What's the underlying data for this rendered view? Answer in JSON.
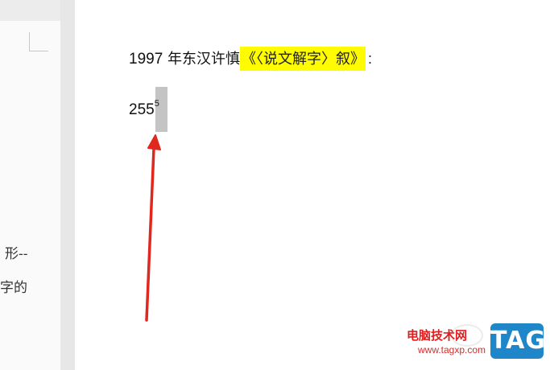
{
  "left_page": {
    "line1": "形--",
    "line2": "字的"
  },
  "document": {
    "para1": {
      "year": "1997",
      "text": " 年东汉许慎",
      "highlighted": "《〈说文解字〉叙》",
      "colon": ":"
    },
    "para2": {
      "base": "255",
      "superscript": "5"
    }
  },
  "watermark": {
    "site_name": "电脑技术网",
    "url": "www.tagxp.com",
    "logo_text": "TAG"
  },
  "colors": {
    "highlight": "#fffb00",
    "arrow": "#e0281e",
    "logo_bg": "#1f86c9",
    "gutter": "#e7e7e7"
  }
}
